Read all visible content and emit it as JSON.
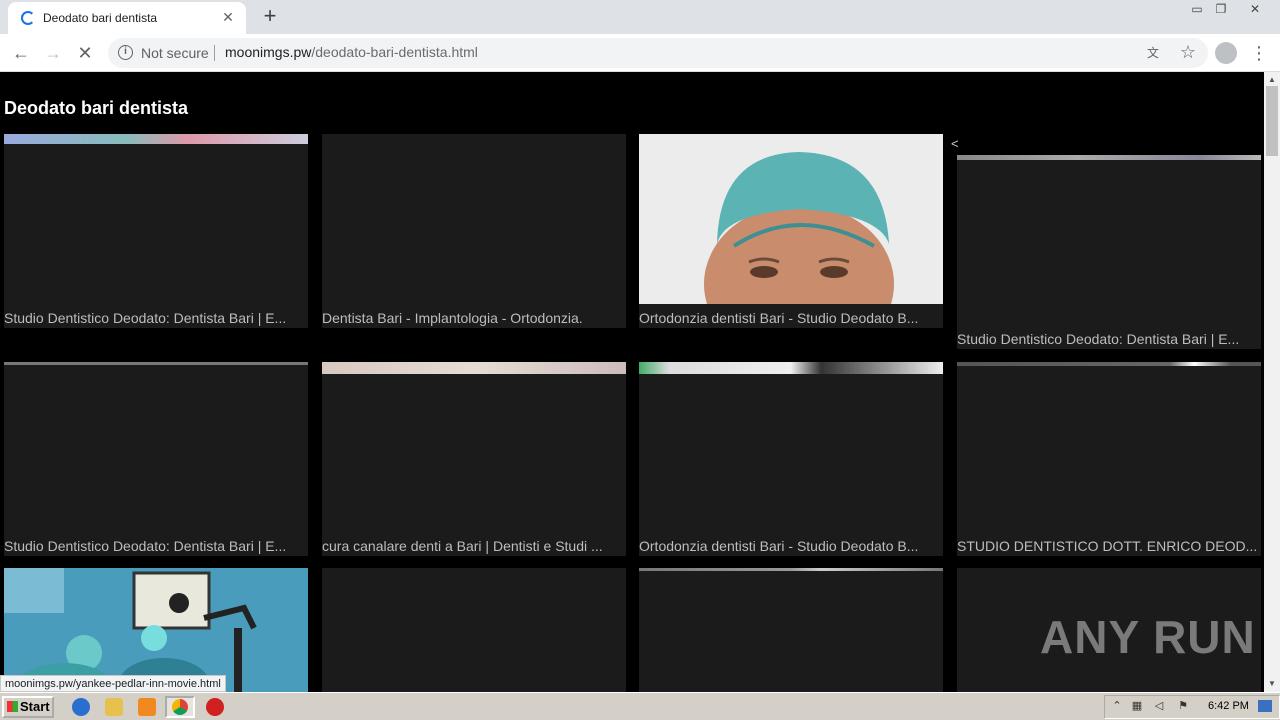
{
  "browser": {
    "tab_title": "Deodato bari dentista",
    "security_label": "Not secure",
    "url_host": "moonimgs.pw",
    "url_path": "/deodato-bari-dentista.html",
    "status_url": "moonimgs.pw/yankee-pedlar-inn-movie.html"
  },
  "page": {
    "heading": "Deodato bari dentista",
    "arrow": "<",
    "cards": [
      {
        "caption": "Studio Dentistico Deodato: Dentista Bari | E..."
      },
      {
        "caption": "Dentista Bari - Implantologia - Ortodonzia."
      },
      {
        "caption": "Ortodonzia dentisti Bari - Studio Deodato B..."
      },
      {
        "caption": "Studio Dentistico Deodato: Dentista Bari | E..."
      },
      {
        "caption": "Studio Dentistico Deodato: Dentista Bari | E..."
      },
      {
        "caption": "cura canalare denti a Bari | Dentisti e Studi ..."
      },
      {
        "caption": "Ortodonzia dentisti Bari - Studio Deodato B..."
      },
      {
        "caption": "STUDIO DENTISTICO DOTT. ENRICO DEOD..."
      }
    ]
  },
  "watermark": "ANY RUN",
  "taskbar": {
    "start_label": "Start",
    "clock": "6:42 PM"
  },
  "colors": {
    "page_bg": "#000000",
    "card_bg": "#1b1b1b",
    "caption": "#bdbdbd",
    "accent": "#1a73e8"
  }
}
